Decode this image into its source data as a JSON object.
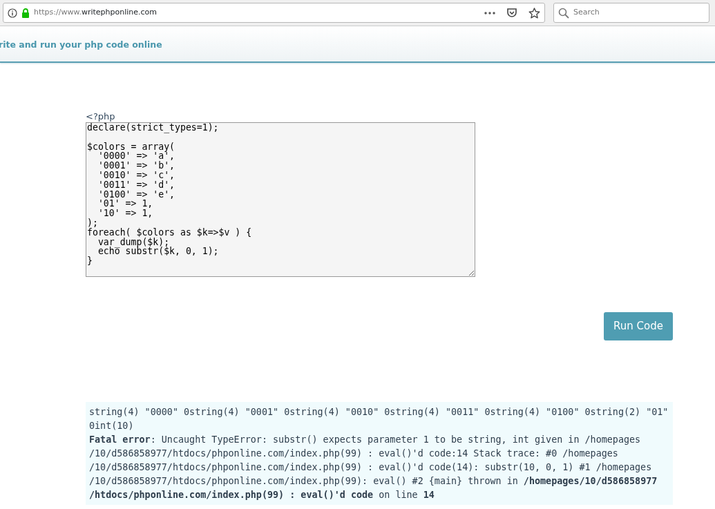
{
  "browser": {
    "url_prefix": "https://www.",
    "url_domain": "writephponline.com",
    "search": {
      "placeholder": "Search"
    }
  },
  "header": {
    "title": "rite and run your php code online"
  },
  "editor": {
    "open_tag": "<?php",
    "code": "declare(strict_types=1);\n\n$colors = array(\n  '0000' => 'a',\n  '0001' => 'b',\n  '0010' => 'c',\n  '0011' => 'd',\n  '0100' => 'e',\n  '01' => 1,\n  '10' => 1,\n);\nforeach( $colors as $k=>$v ) {\n  var_dump($k);\n  echo substr($k, 0, 1);\n}"
  },
  "run_button": "Run Code",
  "output": [
    "string(4) \"0000\" 0string(4) \"0001\" 0string(4) \"0010\" 0string(4) \"0011\" 0string(4) \"0100\" 0string(2) \"01\"",
    "0int(10)",
    "**Fatal error**: Uncaught TypeError: substr() expects parameter 1 to be string, int given in /homepages",
    "/10/d586858977/htdocs/phponline.com/index.php(99) : eval()'d code:14 Stack trace: #0 /homepages",
    "/10/d586858977/htdocs/phponline.com/index.php(99) : eval()'d code(14): substr(10, 0, 1) #1 /homepages",
    "/10/d586858977/htdocs/phponline.com/index.php(99): eval() #2 {main} thrown in **/homepages/10/d586858977**",
    "**/htdocs/phponline.com/index.php(99) : eval()'d code** on line **14**"
  ]
}
